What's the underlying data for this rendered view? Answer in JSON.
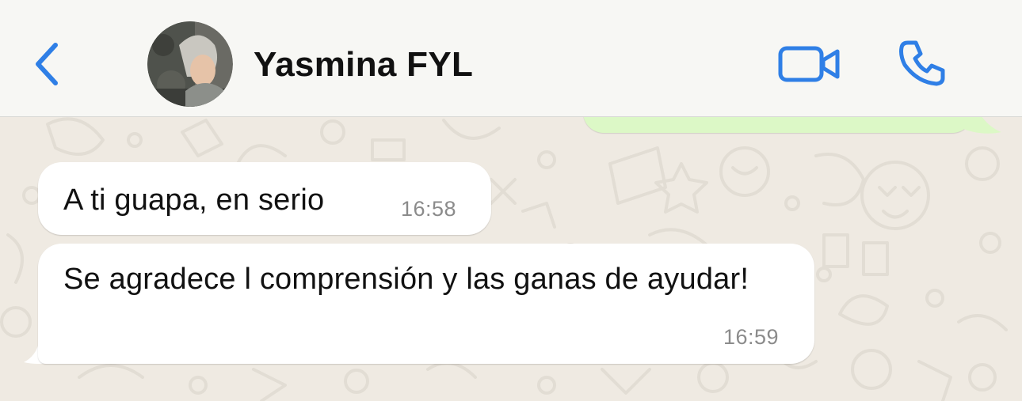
{
  "header": {
    "contact_name": "Yasmina FYL",
    "icons": {
      "back": "chevron-left-icon",
      "video": "video-camera-icon",
      "call": "phone-icon"
    },
    "accent_color": "#2f7fe6"
  },
  "messages": [
    {
      "direction": "incoming",
      "text": "A ti guapa, en serio",
      "time": "16:58"
    },
    {
      "direction": "incoming",
      "text": "Se agradece l comprensión y las ganas de ayudar!",
      "time": "16:59"
    }
  ],
  "colors": {
    "wallpaper": "#efeae2",
    "incoming_bubble": "#ffffff",
    "outgoing_bubble": "#dcf8c6",
    "timestamp": "#8b8b8b"
  }
}
